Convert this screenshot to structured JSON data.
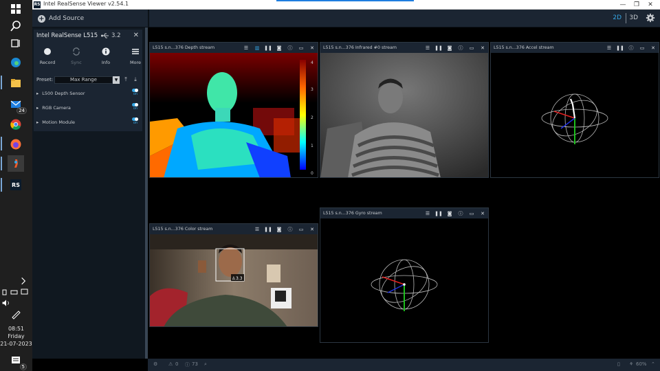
{
  "window": {
    "title": "Intel RealSense Viewer v2.54.1",
    "app_icon": "RS"
  },
  "taskbar": {
    "icons": [
      "windows-start-icon",
      "search-icon",
      "task-view-icon",
      "edge-icon",
      "file-explorer-icon",
      "mail-icon",
      "chrome-icon",
      "firefox-icon",
      "realsense-app-icon",
      "realsense-viewer-icon"
    ],
    "mail_badge": "24",
    "time": "08:51",
    "day": "Friday",
    "date": "21-07-2023",
    "notification_badge": "5"
  },
  "topbar": {
    "add_source": "Add Source",
    "mode_2d": "2D",
    "mode_3d": "3D",
    "accent": "#35a7e6"
  },
  "device": {
    "name": "Intel RealSense L515",
    "usb": "3.2",
    "buttons": [
      {
        "label": "Record",
        "icon": "record-icon"
      },
      {
        "label": "Sync",
        "icon": "sync-icon"
      },
      {
        "label": "Info",
        "icon": "info-icon"
      },
      {
        "label": "More",
        "icon": "menu-icon"
      }
    ],
    "preset_label": "Preset:",
    "preset_value": "Max Range",
    "sensors": [
      {
        "name": "L500 Depth Sensor",
        "state": "on"
      },
      {
        "name": "RGB Camera",
        "state": "on"
      },
      {
        "name": "Motion Module",
        "state": "on"
      }
    ]
  },
  "streams": {
    "depth": {
      "title": "L515 s.n...376 Depth stream",
      "scale": [
        "4",
        "3",
        "2",
        "1",
        "0"
      ]
    },
    "infrared": {
      "title": "L515 s.n...376 Infrared #0 stream"
    },
    "accel": {
      "title": "L515 s.n...376 Accel stream"
    },
    "color": {
      "title": "L515 s.n...376 Color stream",
      "face_distance": "3.3"
    },
    "gyro": {
      "title": "L515 s.n...376 Gyro stream"
    }
  },
  "statusbar": {
    "warnings": "0",
    "info": "73",
    "fps": "60%"
  }
}
